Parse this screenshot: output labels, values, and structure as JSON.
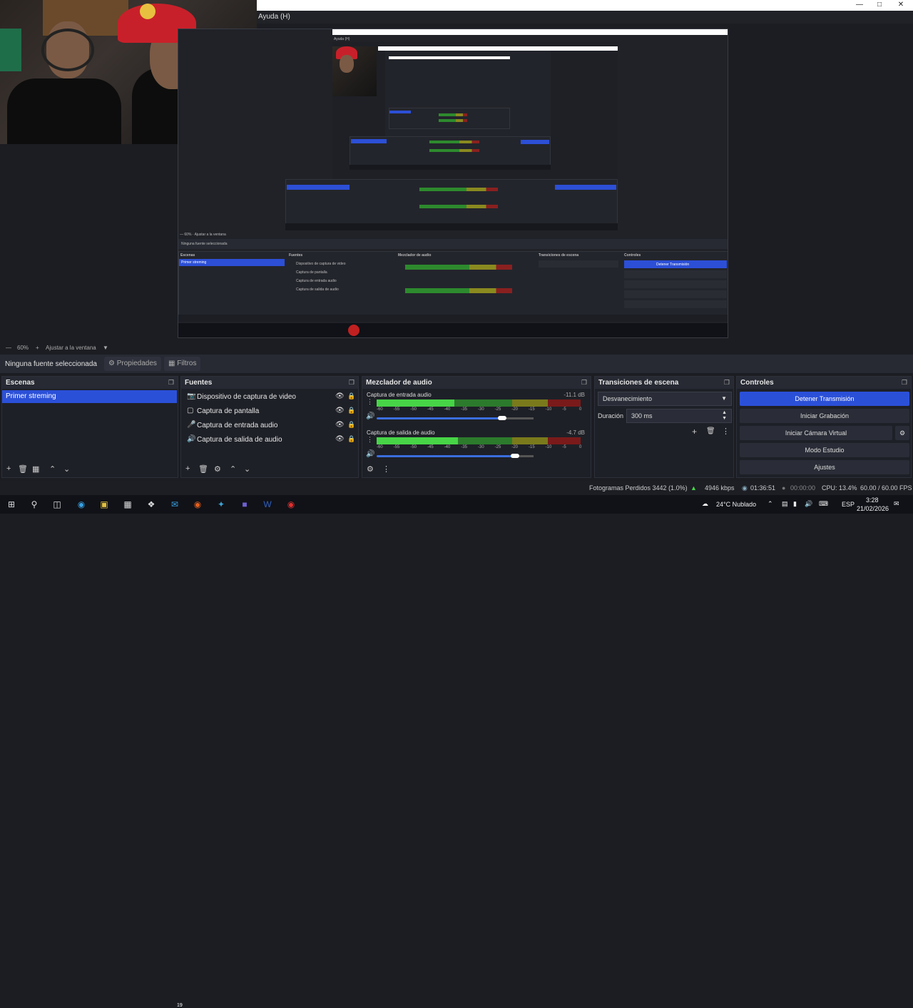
{
  "window": {
    "menu_help": "Ayuda (H)"
  },
  "zoom": {
    "value": "60%",
    "fit_label": "Ajustar a la ventana"
  },
  "source_bar": {
    "no_source": "Ninguna fuente seleccionada",
    "properties": "Propiedades",
    "filters": "Filtros"
  },
  "scenes": {
    "title": "Escenas",
    "items": [
      "Primer streming"
    ]
  },
  "sources": {
    "title": "Fuentes",
    "items": [
      {
        "label": "Dispositivo de captura de video",
        "icon": "camera-icon"
      },
      {
        "label": "Captura de pantalla",
        "icon": "monitor-icon"
      },
      {
        "label": "Captura de entrada audio",
        "icon": "microphone-icon"
      },
      {
        "label": "Captura de salida de audio",
        "icon": "speaker-icon"
      }
    ]
  },
  "mixer": {
    "title": "Mezclador de audio",
    "ticks": [
      "-60",
      "-55",
      "-50",
      "-45",
      "-40",
      "-35",
      "-30",
      "-25",
      "-20",
      "-15",
      "-10",
      "-5",
      "0"
    ],
    "channels": [
      {
        "name": "Captura de entrada audio",
        "db": "-11.1 dB",
        "level": 0.38,
        "volume": 0.8
      },
      {
        "name": "Captura de salida de audio",
        "db": "-4.7 dB",
        "level": 0.4,
        "volume": 0.88
      }
    ]
  },
  "transitions": {
    "title": "Transiciones de escena",
    "selected": "Desvanecimiento",
    "duration_label": "Duración",
    "duration_value": "300 ms"
  },
  "controls": {
    "title": "Controles",
    "stop_stream": "Detener Transmisión",
    "start_record": "Iniciar Grabación",
    "start_virtual_cam": "Iniciar Cámara Virtual",
    "studio_mode": "Modo Estudio",
    "settings": "Ajustes"
  },
  "status": {
    "dropped_frames": "Fotogramas Perdidos 3442 (1.0%)",
    "bitrate": "4946 kbps",
    "stream_time": "01:36:51",
    "record_time": "00:00:00",
    "cpu": "CPU: 13.4%",
    "fps": "60.00 / 60.00 FPS"
  },
  "taskbar": {
    "weather": "24°C  Nublado",
    "lang": "ESP",
    "time": "3:28",
    "date": "21/02/2026",
    "mail_badge": "19"
  }
}
